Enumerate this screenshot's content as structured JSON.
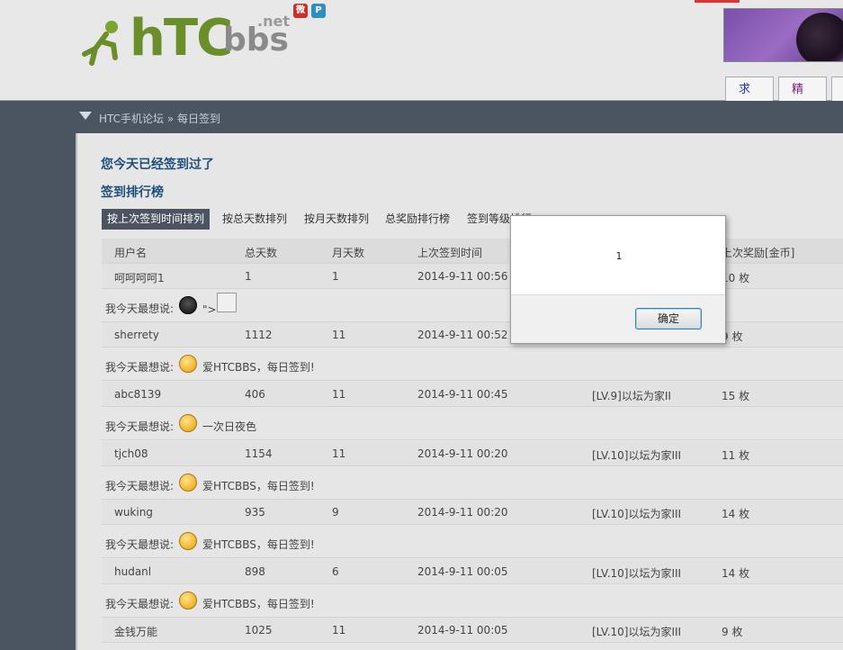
{
  "header": {
    "logo_main": "hTC",
    "logo_sub": "bbs",
    "logo_tld": ".net",
    "social": [
      {
        "name": "weibo-icon",
        "glyph": "微"
      },
      {
        "name": "pinterest-icon",
        "glyph": "P"
      }
    ],
    "nav": {
      "help": "求助",
      "best": "精华"
    }
  },
  "breadcrumb": "HTC手机论坛 » 每日签到",
  "status_title": "您今天已经签到过了",
  "ranking_title": "签到排行榜",
  "sort_tabs": [
    "按上次签到时间排列",
    "按总天数排列",
    "按月天数排列",
    "总奖励排行榜",
    "签到等级排行"
  ],
  "table": {
    "headers": [
      "用户名",
      "总天数",
      "月天数",
      "上次签到时间",
      "",
      "上次奖励[金币]"
    ],
    "say_label": "我今天最想说:",
    "rows": [
      {
        "user": "呵呵呵呵1",
        "total": "1",
        "month": "1",
        "time": "2014-9-11 00:56",
        "level": "",
        "reward": "10 枚",
        "say": "\">"
      },
      {
        "user": "sherrety",
        "total": "1112",
        "month": "11",
        "time": "2014-9-11 00:52",
        "level": "",
        "reward": "9 枚",
        "say": "爱HTCBBS，每日签到!"
      },
      {
        "user": "abc8139",
        "total": "406",
        "month": "11",
        "time": "2014-9-11 00:45",
        "level": "[LV.9]以坛为家II",
        "reward": "15 枚",
        "say": "一次日夜色"
      },
      {
        "user": "tjch08",
        "total": "1154",
        "month": "11",
        "time": "2014-9-11 00:20",
        "level": "[LV.10]以坛为家III",
        "reward": "11 枚",
        "say": "爱HTCBBS，每日签到!"
      },
      {
        "user": "wuking",
        "total": "935",
        "month": "9",
        "time": "2014-9-11 00:20",
        "level": "[LV.10]以坛为家III",
        "reward": "14 枚",
        "say": "爱HTCBBS，每日签到!"
      },
      {
        "user": "hudanl",
        "total": "898",
        "month": "6",
        "time": "2014-9-11 00:05",
        "level": "[LV.10]以坛为家III",
        "reward": "14 枚",
        "say": "爱HTCBBS，每日签到!"
      },
      {
        "user": "金钱万能",
        "total": "1025",
        "month": "11",
        "time": "2014-9-11 00:05",
        "level": "[LV.10]以坛为家III",
        "reward": "9 枚",
        "say": ""
      }
    ]
  },
  "modal": {
    "message": "1",
    "ok_label": "确定"
  }
}
